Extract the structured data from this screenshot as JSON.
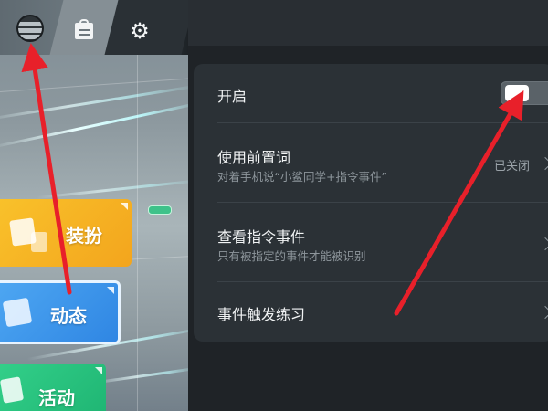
{
  "game_menu": {
    "top_icons": [
      "globe-icon",
      "clipboard-icon",
      "gear-icon"
    ],
    "gear_glyph": "⚙",
    "cards": [
      {
        "label": "装扮",
        "color": "#f6b526"
      },
      {
        "label": "动态",
        "color": "#3c95ea"
      },
      {
        "label": "活动",
        "color": "#2cc682"
      }
    ]
  },
  "settings": {
    "toggle_row": {
      "title": "开启",
      "toggle_state": "on"
    },
    "wake_word_row": {
      "title": "使用前置词",
      "subtitle": "对着手机说“小鲨同学+指令事件”",
      "status": "已关闭"
    },
    "events_row": {
      "title": "查看指令事件",
      "subtitle": "只有被指定的事件才能被识别"
    },
    "practice_row": {
      "title": "事件触发练习"
    }
  },
  "annotation": {
    "arrow_color": "#e8202a",
    "arrow_count": 2
  }
}
